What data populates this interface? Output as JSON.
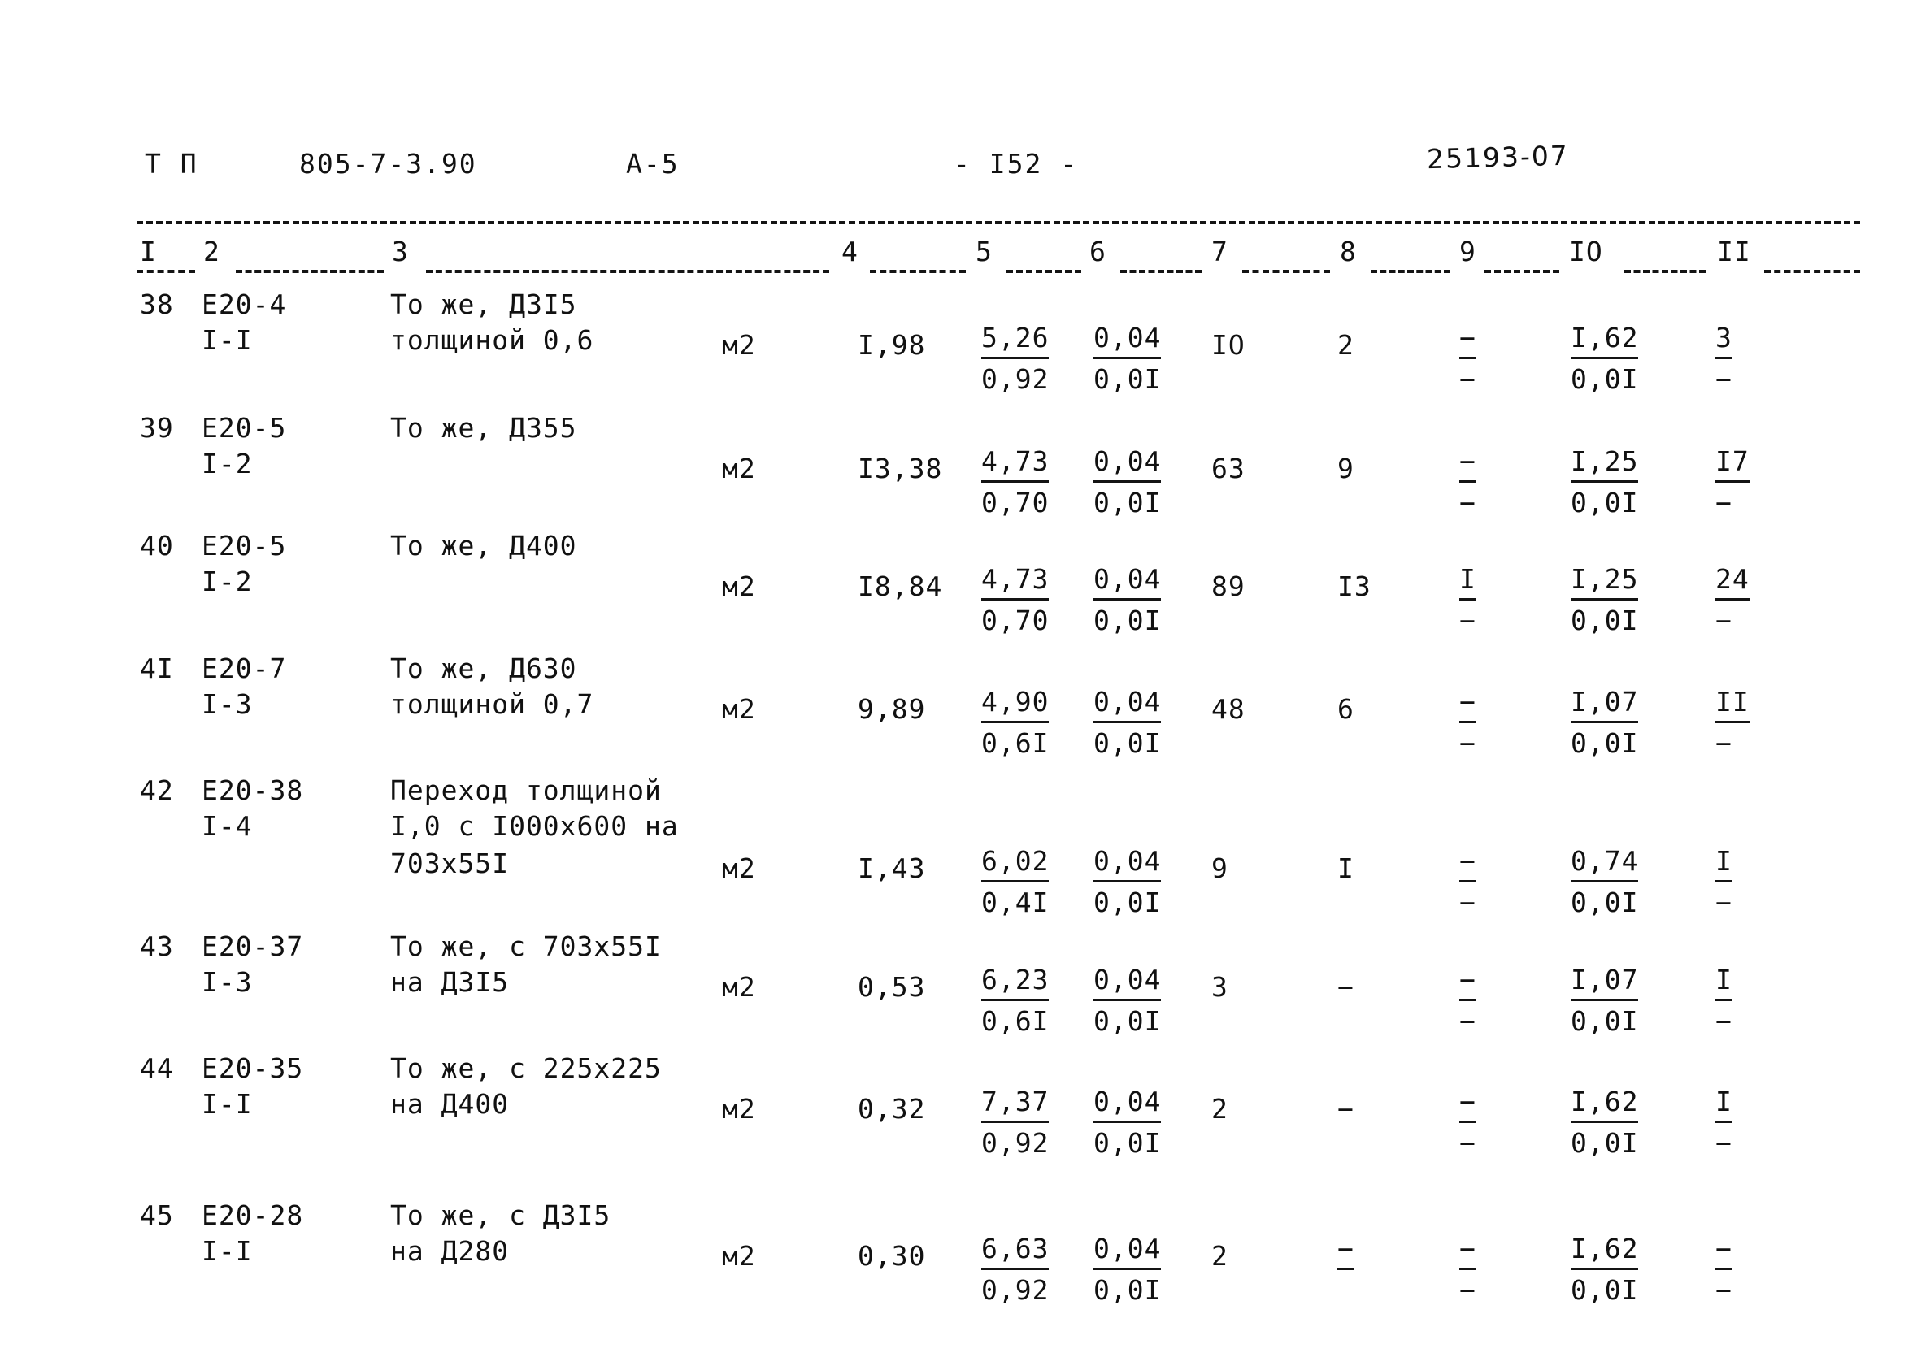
{
  "header": {
    "doc_type": "Т П",
    "doc_code": "805-7-3.90",
    "section": "А-5",
    "page_number": "- I52 -",
    "stamp": "25193-07"
  },
  "column_headers": [
    "I",
    "2",
    "3",
    "4",
    "5",
    "6",
    "7",
    "8",
    "9",
    "IO",
    "II"
  ],
  "rows": [
    {
      "num": "38",
      "code_line1": "Е20-4",
      "code_line2": "I-I",
      "desc_line1": "То же, ДЗI5",
      "desc_line2": "толщиной 0,6",
      "desc_line3": "",
      "unit": "м2",
      "c4": "I,98",
      "c5_top": "5,26",
      "c5_bot": "0,92",
      "c6_top": "0,04",
      "c6_bot": "0,0I",
      "c7": "IO",
      "c8": "2",
      "c9_top": "−",
      "c9_bot": "−",
      "c10_top": "I,62",
      "c10_bot": "0,0I",
      "c11_top": "3",
      "c11_bot": "−"
    },
    {
      "num": "39",
      "code_line1": "Е20-5",
      "code_line2": "I-2",
      "desc_line1": "То же, Д355",
      "desc_line2": "",
      "desc_line3": "",
      "unit": "м2",
      "c4": "I3,38",
      "c5_top": "4,73",
      "c5_bot": "0,70",
      "c6_top": "0,04",
      "c6_bot": "0,0I",
      "c7": "63",
      "c8": "9",
      "c9_top": "−",
      "c9_bot": "−",
      "c10_top": "I,25",
      "c10_bot": "0,0I",
      "c11_top": "I7",
      "c11_bot": "−"
    },
    {
      "num": "40",
      "code_line1": "Е20-5",
      "code_line2": "I-2",
      "desc_line1": "То же, Д400",
      "desc_line2": "",
      "desc_line3": "",
      "unit": "м2",
      "c4": "I8,84",
      "c5_top": "4,73",
      "c5_bot": "0,70",
      "c6_top": "0,04",
      "c6_bot": "0,0I",
      "c7": "89",
      "c8": "I3",
      "c9_top": "I",
      "c9_bot": "−",
      "c10_top": "I,25",
      "c10_bot": "0,0I",
      "c11_top": "24",
      "c11_bot": "−"
    },
    {
      "num": "4I",
      "code_line1": "Е20-7",
      "code_line2": "I-3",
      "desc_line1": "То же, Д630",
      "desc_line2": "толщиной 0,7",
      "desc_line3": "",
      "unit": "м2",
      "c4": "9,89",
      "c5_top": "4,90",
      "c5_bot": "0,6I",
      "c6_top": "0,04",
      "c6_bot": "0,0I",
      "c7": "48",
      "c8": "6",
      "c9_top": "−",
      "c9_bot": "−",
      "c10_top": "I,07",
      "c10_bot": "0,0I",
      "c11_top": "II",
      "c11_bot": "−"
    },
    {
      "num": "42",
      "code_line1": "Е20-38",
      "code_line2": "I-4",
      "desc_line1": "Переход толщиной",
      "desc_line2": "I,0 с I000х600 на",
      "desc_line3": "703х55I",
      "unit": "м2",
      "c4": "I,43",
      "c5_top": "6,02",
      "c5_bot": "0,4I",
      "c6_top": "0,04",
      "c6_bot": "0,0I",
      "c7": "9",
      "c8": "I",
      "c9_top": "−",
      "c9_bot": "−",
      "c10_top": "0,74",
      "c10_bot": "0,0I",
      "c11_top": "I",
      "c11_bot": "−"
    },
    {
      "num": "43",
      "code_line1": "Е20-37",
      "code_line2": "I-3",
      "desc_line1": "То же, с 703х55I",
      "desc_line2": "на ДЗI5",
      "desc_line3": "",
      "unit": "м2",
      "c4": "0,53",
      "c5_top": "6,23",
      "c5_bot": "0,6I",
      "c6_top": "0,04",
      "c6_bot": "0,0I",
      "c7": "3",
      "c8": "−",
      "c9_top": "−",
      "c9_bot": "−",
      "c10_top": "I,07",
      "c10_bot": "0,0I",
      "c11_top": "I",
      "c11_bot": "−"
    },
    {
      "num": "44",
      "code_line1": "Е20-35",
      "code_line2": "I-I",
      "desc_line1": "То же, с 225х225",
      "desc_line2": "на Д400",
      "desc_line3": "",
      "unit": "м2",
      "c4": "0,32",
      "c5_top": "7,37",
      "c5_bot": "0,92",
      "c6_top": "0,04",
      "c6_bot": "0,0I",
      "c7": "2",
      "c8": "−",
      "c9_top": "−",
      "c9_bot": "−",
      "c10_top": "I,62",
      "c10_bot": "0,0I",
      "c11_top": "I",
      "c11_bot": "−"
    },
    {
      "num": "45",
      "code_line1": "Е20-28",
      "code_line2": "I-I",
      "desc_line1": "То же, с ДЗI5",
      "desc_line2": "на Д280",
      "desc_line3": "",
      "unit": "м2",
      "c4": "0,30",
      "c5_top": "6,63",
      "c5_bot": "0,92",
      "c6_top": "0,04",
      "c6_bot": "0,0I",
      "c7": "2",
      "c8": "−",
      "c9_top": "−",
      "c9_bot": "−",
      "c10_top": "I,62",
      "c10_bot": "0,0I",
      "c11_top": "−",
      "c11_bot": "−"
    }
  ]
}
